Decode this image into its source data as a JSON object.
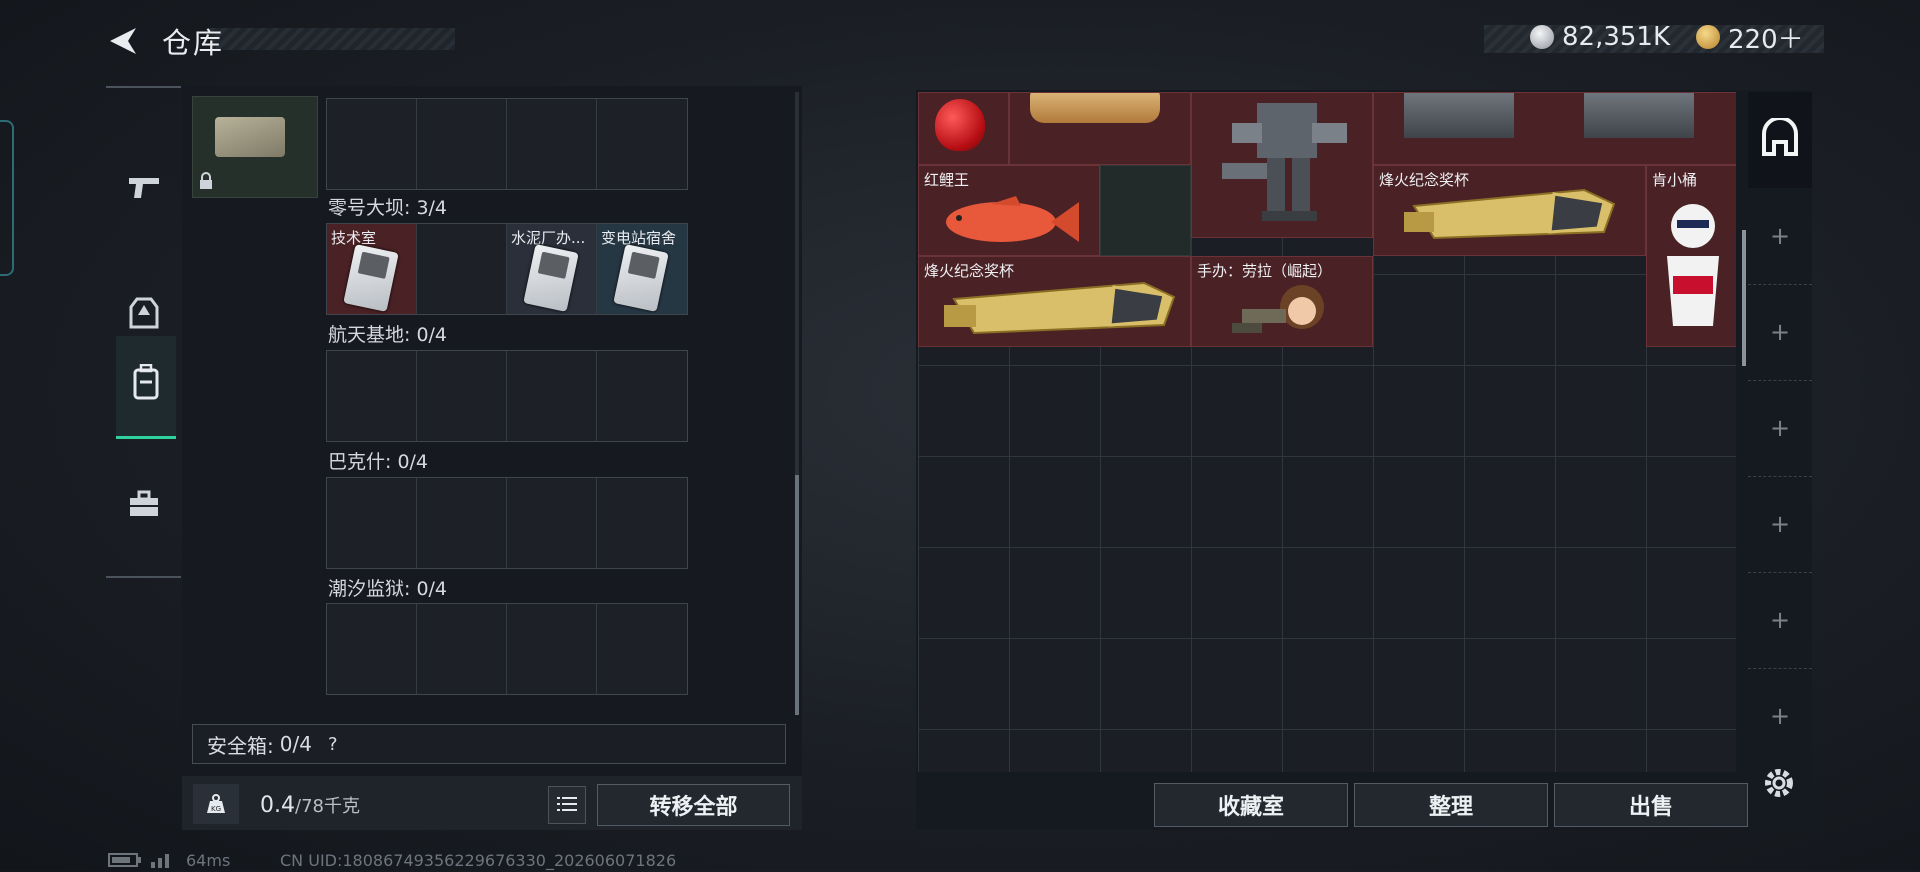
{
  "header": {
    "title": "仓库",
    "currency_primary": "82,351K",
    "currency_secondary": "220＋"
  },
  "left_nav": {
    "items": [
      {
        "icon": "pistol-icon"
      },
      {
        "icon": "armor-icon"
      },
      {
        "icon": "backpack-icon",
        "active": true
      },
      {
        "icon": "briefcase-icon"
      }
    ]
  },
  "collection": {
    "sections": [
      {
        "title": "零号大坝: 3/4",
        "cells": [
          "技术室",
          "",
          "水泥厂办...",
          "变电站宿舍"
        ]
      },
      {
        "title": "航天基地: 0/4",
        "cells": [
          "",
          "",
          "",
          ""
        ]
      },
      {
        "title": "巴克什: 0/4",
        "cells": [
          "",
          "",
          "",
          ""
        ]
      },
      {
        "title": "潮汐监狱: 0/4",
        "cells": [
          "",
          "",
          "",
          ""
        ]
      }
    ]
  },
  "safe_box": {
    "label": "安全箱:",
    "value": "0/4",
    "help": "?"
  },
  "weight": {
    "icon_text": "KG",
    "current": "0.4",
    "max": "/78千克"
  },
  "buttons": {
    "transfer_all": "转移全部",
    "collection_room": "收藏室",
    "organize": "整理",
    "sell": "出售"
  },
  "bag_items": [
    {
      "label": "红鲤王"
    },
    {
      "label": "烽火纪念奖杯"
    },
    {
      "label": "肯小桶"
    },
    {
      "label": "烽火纪念奖杯"
    },
    {
      "label": "手办：劳拉（崛起）"
    }
  ],
  "footer": {
    "ping": "64ms",
    "uid": "CN UID:18086749356229676330_202606071826"
  },
  "colors": {
    "accent": "#2fd19d",
    "item_bg": "#4a2124"
  }
}
